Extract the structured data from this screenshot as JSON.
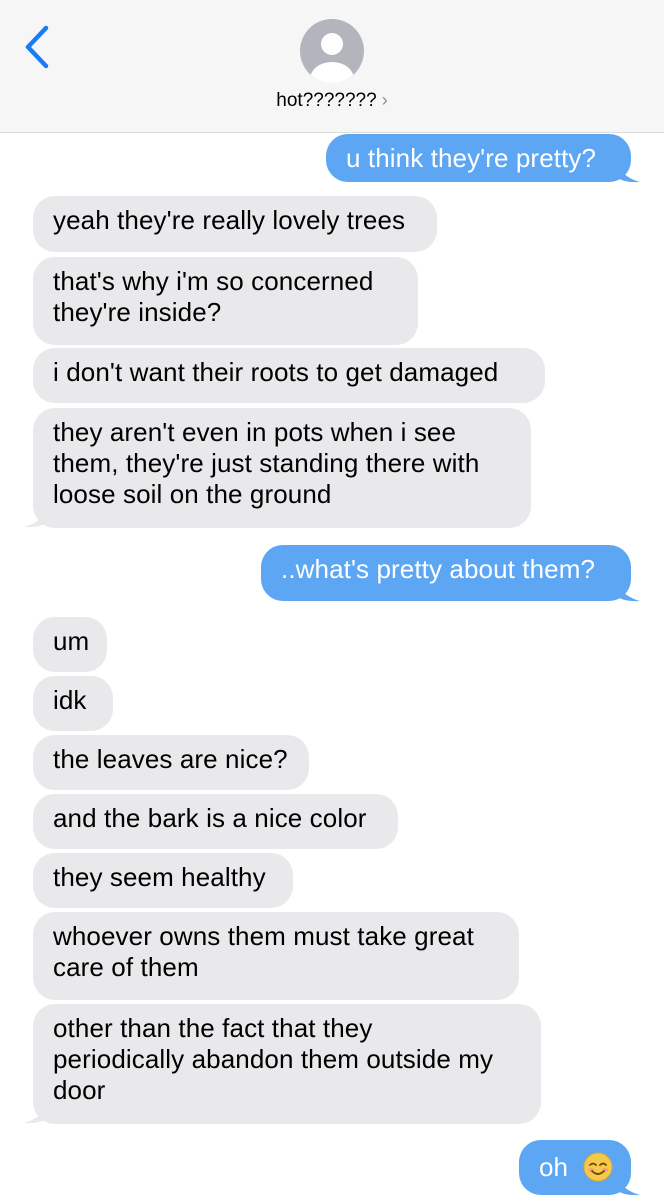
{
  "header": {
    "contact_name": "hot???????",
    "chevron": "›",
    "back_icon": "chevron-left-icon",
    "avatar_icon": "person-silhouette-icon"
  },
  "colors": {
    "sent_bubble": "#5ca6f4",
    "received_bubble": "#e9e9eb",
    "back_icon": "#1a7cf5",
    "header_bg": "#f6f6f6"
  },
  "messages": [
    {
      "sender": "me",
      "text": "u think they're pretty?"
    },
    {
      "sender": "them",
      "text": "yeah they're really lovely trees"
    },
    {
      "sender": "them",
      "lines": [
        "that's why i'm so concerned",
        "they're inside?"
      ]
    },
    {
      "sender": "them",
      "text": "i don't want their roots to get damaged"
    },
    {
      "sender": "them",
      "lines": [
        "they aren't even in pots when i see",
        "them, they're just standing there with",
        "loose soil on the ground"
      ]
    },
    {
      "sender": "me",
      "text": "..what's pretty about them?"
    },
    {
      "sender": "them",
      "text": "um"
    },
    {
      "sender": "them",
      "text": "idk"
    },
    {
      "sender": "them",
      "text": "the leaves are nice?"
    },
    {
      "sender": "them",
      "text": "and the bark is a nice color"
    },
    {
      "sender": "them",
      "text": "they seem healthy"
    },
    {
      "sender": "them",
      "lines": [
        "whoever owns them must take great",
        "care of them"
      ]
    },
    {
      "sender": "them",
      "lines": [
        "other than the fact that they",
        "periodically abandon them outside my",
        "door"
      ]
    },
    {
      "sender": "me",
      "text": "oh",
      "emoji": "smiling-face-icon"
    }
  ]
}
